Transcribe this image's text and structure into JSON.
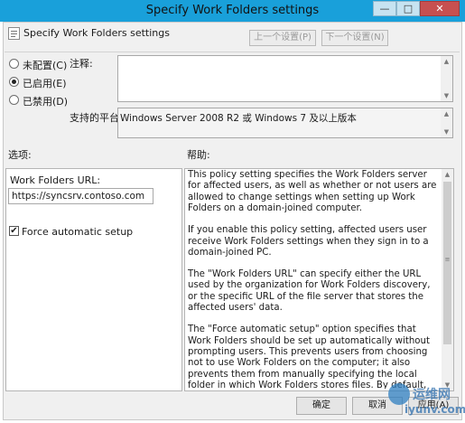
{
  "window": {
    "title": "Specify Work Folders settings",
    "controls": {
      "minimize": "—",
      "maximize": "□",
      "close": "✕"
    }
  },
  "header": {
    "policy_name": "Specify Work Folders settings",
    "prev_button": "上一个设置(P)",
    "next_button": "下一个设置(N)"
  },
  "state": {
    "options": [
      {
        "label": "未配置(C)",
        "selected": false
      },
      {
        "label": "已启用(E)",
        "selected": true
      },
      {
        "label": "已禁用(D)",
        "selected": false
      }
    ]
  },
  "comment": {
    "label": "注释:",
    "value": ""
  },
  "platform": {
    "label": "支持的平台:",
    "value": "Windows Server 2008 R2 或 Windows 7 及以上版本"
  },
  "options_panel": {
    "label": "选项:",
    "url_label": "Work Folders URL:",
    "url_value": "https://syncsrv.contoso.com",
    "force_label": "Force automatic setup",
    "force_checked": true
  },
  "help_panel": {
    "label": "帮助:",
    "paragraphs": [
      "This policy setting specifies the Work Folders server for affected users, as well as whether or not users are allowed to change settings when setting up Work Folders on a domain-joined computer.",
      "If you enable this policy setting, affected users user receive Work Folders settings when they sign in to a domain-joined PC.",
      "The \"Work Folders URL\" can specify either the URL used by the organization for Work Folders discovery, or the specific URL of the file server that stores the affected users' data.",
      "The \"Force automatic setup\" option specifies that Work Folders should be set up automatically without prompting users. This prevents users from choosing not to use Work Folders on the computer; it also prevents them from manually specifying the local folder in which Work Folders stores files. By default, Work Folders is stored in the \"%USERPROFILE%\\Work Folders\" folder. If this option is not specified, users must use the Work Folders"
    ]
  },
  "footer": {
    "ok_button": "确定",
    "cancel_button": "取消",
    "apply_button": "应用(A)"
  },
  "watermark": {
    "text_cn": "运维网",
    "text_url": "iyunv.com"
  },
  "colors": {
    "titlebar": "#19a0da",
    "close": "#c75050",
    "panel": "#f0f0f0"
  }
}
